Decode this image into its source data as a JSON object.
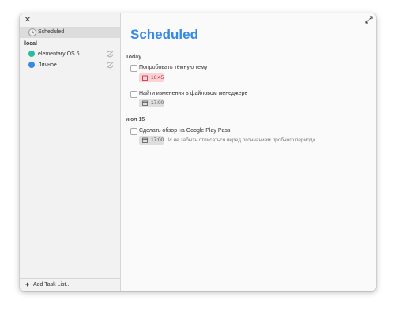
{
  "window": {
    "close_icon": "close-icon",
    "expand_icon": "expand-icon"
  },
  "sidebar": {
    "scheduled_label": "Scheduled",
    "section_label": "local",
    "lists": [
      {
        "label": "elementary OS 6",
        "color": "#28bca3",
        "icon": "sync-off-icon"
      },
      {
        "label": "Личное",
        "color": "#3689e6",
        "icon": "sync-off-icon"
      }
    ],
    "add_list_label": "Add Task List..."
  },
  "main": {
    "title": "Scheduled",
    "groups": [
      {
        "header": "Today",
        "tasks": [
          {
            "title": "Попробовать тёмную тему",
            "time": "16:45",
            "overdue": true,
            "note": ""
          },
          {
            "title": "Найти изменения в файловом менеджере",
            "time": "17:00",
            "overdue": false,
            "note": ""
          }
        ]
      },
      {
        "header": "июл 15",
        "tasks": [
          {
            "title": "Сделать обзор на Google Play Pass",
            "time": "17:00",
            "overdue": false,
            "note": "И не забыть отписаться перед окончанием пробного периода."
          }
        ]
      }
    ]
  },
  "colors": {
    "accent": "#3689e6",
    "overdue_text": "#c6262e",
    "overdue_bg": "#f9d4d6"
  }
}
